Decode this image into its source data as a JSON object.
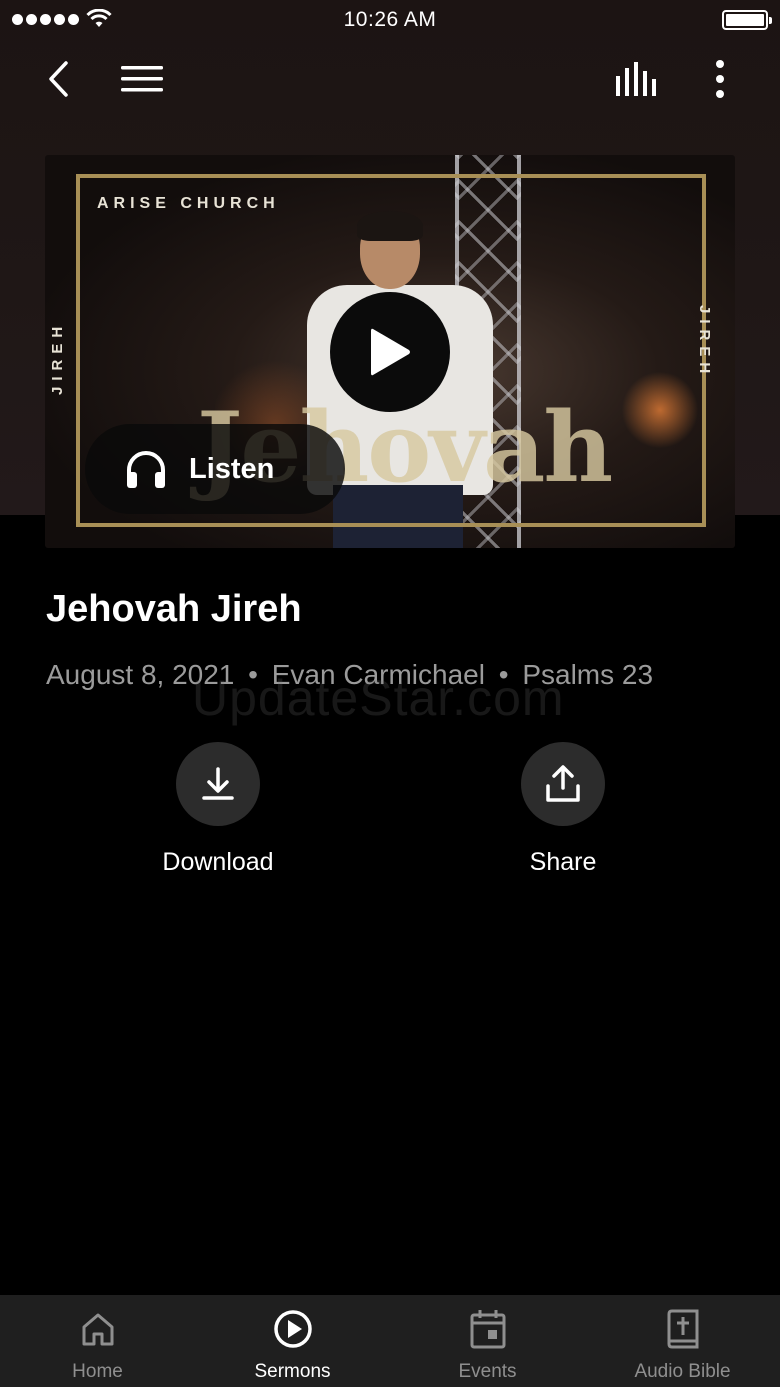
{
  "status_bar": {
    "time": "10:26 AM"
  },
  "artwork": {
    "church_name": "ARISE CHURCH",
    "side_text_left": "JIREH",
    "side_text_right": "JIREH",
    "title_art": "Jehovah",
    "listen_label": "Listen"
  },
  "sermon": {
    "title": "Jehovah Jireh",
    "date": "August 8, 2021",
    "speaker": "Evan Carmichael",
    "scripture": "Psalms 23",
    "separator": "•"
  },
  "watermark": "UpdateStar.com",
  "actions": {
    "download_label": "Download",
    "share_label": "Share"
  },
  "tabs": [
    {
      "label": "Home",
      "icon": "home-icon",
      "active": false
    },
    {
      "label": "Sermons",
      "icon": "play-circle-icon",
      "active": true
    },
    {
      "label": "Events",
      "icon": "calendar-icon",
      "active": false
    },
    {
      "label": "Audio Bible",
      "icon": "bible-icon",
      "active": false
    }
  ],
  "colors": {
    "background": "#000000",
    "header_background": "#1f1716",
    "gold_accent": "#a88f56",
    "tab_bar": "#1f1f1f",
    "inactive_tab": "#8f8f8f",
    "meta_text": "#9b9b9b"
  }
}
